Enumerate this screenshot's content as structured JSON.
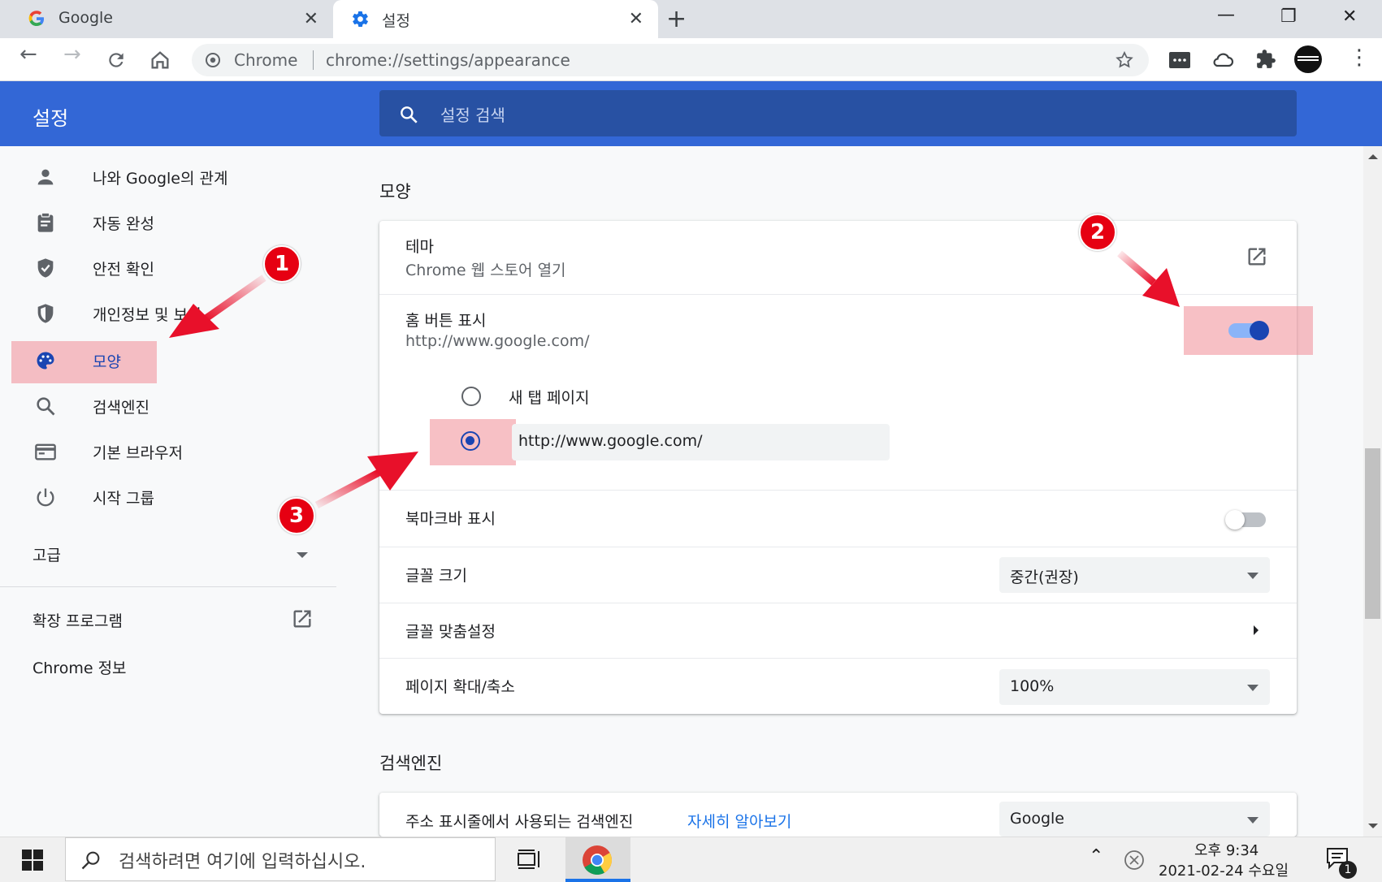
{
  "tabs": [
    {
      "title": "Google",
      "close": "✕"
    },
    {
      "title": "설정",
      "close": "✕"
    }
  ],
  "new_tab": "+",
  "window_controls": {
    "minimize": "—",
    "maximize": "❐",
    "close": "✕"
  },
  "omnibox": {
    "site": "Chrome",
    "url": "chrome://settings/appearance"
  },
  "header": {
    "title": "설정",
    "search_placeholder": "설정 검색"
  },
  "sidebar": {
    "items": [
      {
        "label": "나와 Google의 관계",
        "icon": "person-icon"
      },
      {
        "label": "자동 완성",
        "icon": "clipboard-icon"
      },
      {
        "label": "안전 확인",
        "icon": "shield-check-icon"
      },
      {
        "label": "개인정보 및 보안",
        "icon": "shield-icon"
      },
      {
        "label": "모양",
        "icon": "palette-icon"
      },
      {
        "label": "검색엔진",
        "icon": "search-icon"
      },
      {
        "label": "기본 브라우저",
        "icon": "browser-icon"
      },
      {
        "label": "시작 그룹",
        "icon": "power-icon"
      }
    ],
    "advanced": "고급",
    "extensions": "확장 프로그램",
    "about": "Chrome 정보"
  },
  "appearance": {
    "section_title": "모양",
    "theme_label": "테마",
    "theme_sub": "Chrome 웹 스토어 열기",
    "home_label": "홈 버튼 표시",
    "home_sub": "http://www.google.com/",
    "home_toggle_on": true,
    "radio_new_tab": "새 탭 페이지",
    "radio_custom_url": "http://www.google.com/",
    "bookmarks_label": "북마크바 표시",
    "bookmarks_toggle_on": false,
    "font_size_label": "글꼴 크기",
    "font_size_value": "중간(권장)",
    "customize_fonts_label": "글꼴 맞춤설정",
    "zoom_label": "페이지 확대/축소",
    "zoom_value": "100%"
  },
  "search_engine": {
    "section_title": "검색엔진",
    "row_label": "주소 표시줄에서 사용되는 검색엔진",
    "learn_more": "자세히 알아보기",
    "value": "Google"
  },
  "annotations": [
    "1",
    "2",
    "3"
  ],
  "taskbar": {
    "search_placeholder": "검색하려면 여기에 입력하십시오.",
    "time": "오후 9:34",
    "date": "2021-02-24 수요일",
    "notification_count": "1"
  },
  "colors": {
    "header": "#3367d6",
    "accent": "#1a45b2",
    "marker": "#e60012"
  }
}
